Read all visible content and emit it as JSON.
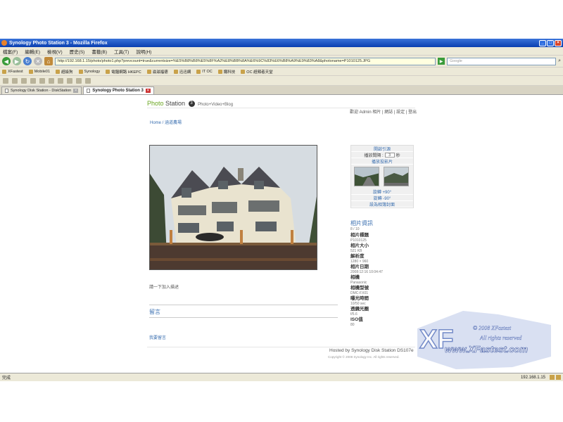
{
  "window": {
    "title": "Synology Photo Station 3 - Mozilla Firefox"
  },
  "menu": [
    "檔案(F)",
    "編輯(E)",
    "檢視(V)",
    "歷史(S)",
    "書籤(B)",
    "工具(T)",
    "說明(H)"
  ],
  "nav": {
    "url": "http://192.168.1.15/photo/photo1.php?prevcount=true&currentsize=%E5%B8%B8%E5%8F%A2%E8%BB%8A%E6%9C%83%E6%B8%A9%E9%83%A8&photoname=P1010125.JPG",
    "search_placeholder": "Google"
  },
  "bookmarks": [
    "XFastest",
    "Mobile01",
    "超級狗",
    "Synology",
    "電腦網路 HKEPC",
    "滋滋福德",
    "迅迅網",
    "IT OC",
    "鐵科技",
    "OC 超頻者天堂"
  ],
  "tabs": [
    {
      "label": "Synology Disk Station - DiskStation",
      "active": false
    },
    {
      "label": "Synology Photo Station 3",
      "active": true
    }
  ],
  "page": {
    "brand_photo": "Photo",
    "brand_station": " Station",
    "brand_num": "3",
    "brand_tag": "Photo+Video+Blog",
    "user_nav": "歡迎 Admin  相片 | 網誌 | 設定 | 登出",
    "breadcrumb": "Home / 涵道農場",
    "add_description": "請一下加入描述",
    "comments_title": "留言",
    "add_comment": "我要留言"
  },
  "sidebar": {
    "slideshow_title": "開啟引源",
    "interval_label": "播放間隔 :",
    "interval_value": "3",
    "interval_unit": "秒",
    "play_slideshow": "播放投影片",
    "rotate_cw": "旋轉 +90°",
    "rotate_ccw": "旋轉 -90°",
    "set_cover": "設為相簿封面"
  },
  "info": {
    "title": "相片資訊",
    "position": "8 / 10",
    "items": [
      {
        "label": "相片標題",
        "value": "P1010125"
      },
      {
        "label": "相片大小",
        "value": "521 KB"
      },
      {
        "label": "解析度",
        "value": "1280 × 960"
      },
      {
        "label": "相片日期",
        "value": "2008:12:16 10:04:47"
      },
      {
        "label": "相機",
        "value": "Panasonic"
      },
      {
        "label": "相機型號",
        "value": "DMC-FX01"
      },
      {
        "label": "曝光時間",
        "value": "10/50 sec"
      },
      {
        "label": "透鏡光圈",
        "value": "f/5.6"
      },
      {
        "label": "ISO值",
        "value": "80"
      }
    ]
  },
  "footer": {
    "hosted": "Hosted by Synology Disk Station DS107e",
    "copyright": "Copyright © 2008 Synology Inc. All rights reserved."
  },
  "watermark": {
    "line1": "© 2008 XFastest",
    "line2": "All rights reserved",
    "url": "www.XFastest.com"
  },
  "status": {
    "text": "完成",
    "ip": "192.168.1.15"
  }
}
